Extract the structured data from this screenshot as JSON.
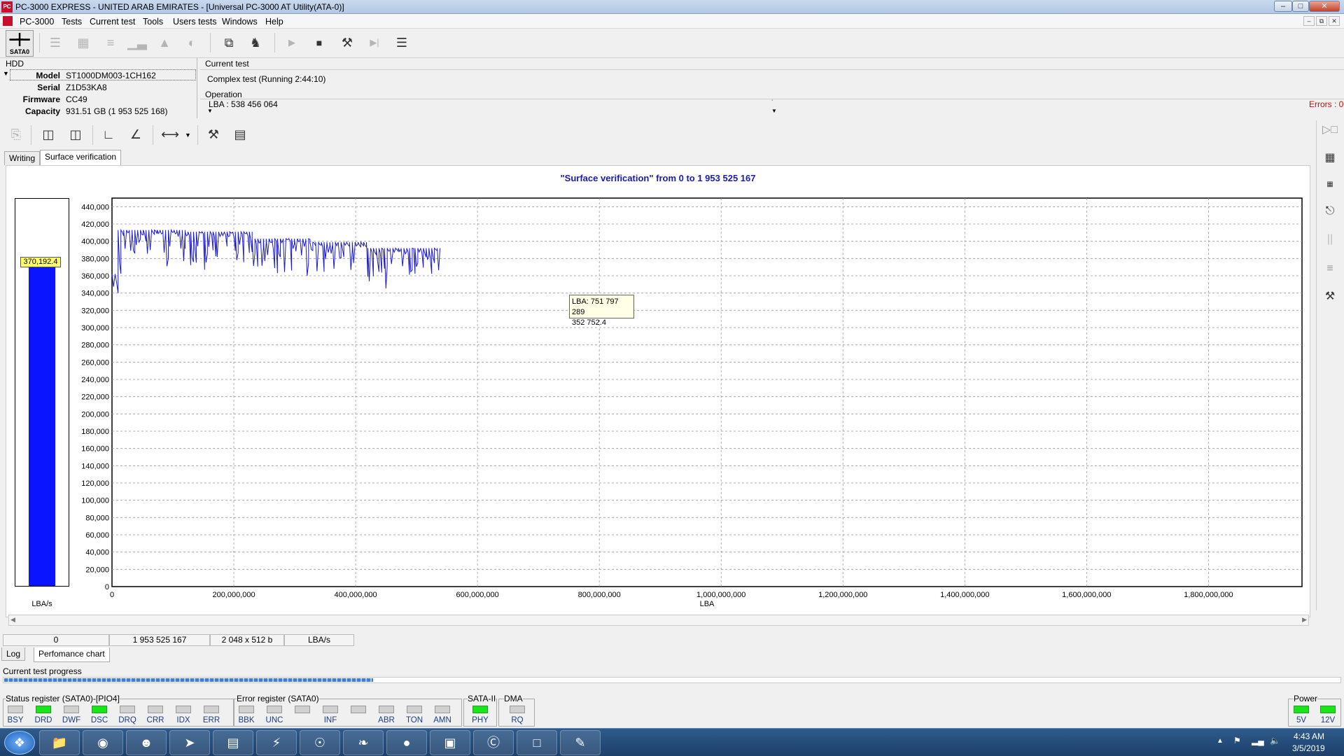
{
  "window": {
    "title": "PC-3000 EXPRESS - UNITED ARAB EMIRATES - [Universal PC-3000 AT Utility(ATA-0)]",
    "app_icon_text": "PC"
  },
  "menu": {
    "items": [
      "PC-3000",
      "Tests",
      "Current test",
      "Tools",
      "Users tests",
      "Windows",
      "Help"
    ]
  },
  "toolbar": {
    "sata_label": "SATA0"
  },
  "hdd": {
    "group_title": "HDD",
    "fields": [
      {
        "label": "Model",
        "value": "ST1000DM003-1CH162"
      },
      {
        "label": "Serial",
        "value": "Z1D53KA8"
      },
      {
        "label": "Firmware",
        "value": "CC49"
      },
      {
        "label": "Capacity",
        "value": "931.51 GB (1 953 525 168)"
      }
    ]
  },
  "current_test": {
    "group_title": "Current test",
    "value": "Complex test (Running 2:44:10)"
  },
  "operation": {
    "group_title": "Operation",
    "value": "LBA : 538 456 064",
    "errors_label": "Errors : 0"
  },
  "tabs": {
    "items": [
      "Writing",
      "Surface verification"
    ],
    "active": "Surface verification"
  },
  "chart_title": "\"Surface verification\" from 0 to 1 953 525 167",
  "gauge": {
    "value_label": "370,192.4",
    "value": 370192.4,
    "unit": "LBA/s",
    "max": 450000
  },
  "tooltip": {
    "line1": "LBA: 751 797 289",
    "line2": "352 752.4"
  },
  "chart_data": {
    "type": "line",
    "title": "\"Surface verification\" from 0 to 1 953 525 167",
    "xlabel": "LBA",
    "ylabel": "LBA/s",
    "xlim": [
      0,
      1953525167
    ],
    "ylim": [
      0,
      450000
    ],
    "yticks": [
      0,
      20000,
      40000,
      60000,
      80000,
      100000,
      120000,
      140000,
      160000,
      180000,
      200000,
      220000,
      240000,
      260000,
      280000,
      300000,
      320000,
      340000,
      360000,
      380000,
      400000,
      420000,
      440000
    ],
    "ytick_labels": [
      "0",
      "20,000",
      "40,000",
      "60,000",
      "80,000",
      "100,000",
      "120,000",
      "140,000",
      "160,000",
      "180,000",
      "200,000",
      "220,000",
      "240,000",
      "260,000",
      "280,000",
      "300,000",
      "320,000",
      "340,000",
      "360,000",
      "380,000",
      "400,000",
      "420,000",
      "440,000"
    ],
    "xticks": [
      0,
      200000000,
      400000000,
      600000000,
      800000000,
      1000000000,
      1200000000,
      1400000000,
      1600000000,
      1800000000
    ],
    "xtick_labels": [
      "0",
      "200,000,000",
      "400,000,000",
      "600,000,000",
      "800,000,000",
      "1,000,000,000",
      "1,200,000,000",
      "1,400,000,000",
      "1,600,000,000",
      "1,800,000,000"
    ],
    "grid": true,
    "series": [
      {
        "color": "#1a1acc",
        "segments": [
          {
            "x0": 0,
            "x1": 10000000,
            "y": 362000,
            "dip": 318000
          },
          {
            "x0": 10000000,
            "x1": 120000000,
            "y": 413000,
            "dip": 360000
          },
          {
            "x0": 120000000,
            "x1": 230000000,
            "y": 411000,
            "dip": 358000
          },
          {
            "x0": 230000000,
            "x1": 325000000,
            "y": 403000,
            "dip": 352000
          },
          {
            "x0": 325000000,
            "x1": 420000000,
            "y": 399000,
            "dip": 348000
          },
          {
            "x0": 420000000,
            "x1": 538456064,
            "y": 392000,
            "dip": 344000
          }
        ]
      }
    ]
  },
  "status_strip": {
    "cells": [
      "0",
      "1 953 525 167",
      "2 048 x 512 b",
      "LBA/s"
    ]
  },
  "bottom_tabs": {
    "items": [
      "Log",
      "Perfomance chart"
    ],
    "active": "Perfomance chart"
  },
  "progress": {
    "label": "Current test progress",
    "fraction": 0.276
  },
  "status_register": {
    "title": "Status register (SATA0)-[PIO4]",
    "leds": [
      {
        "name": "BSY",
        "on": false
      },
      {
        "name": "DRD",
        "on": true
      },
      {
        "name": "DWF",
        "on": false
      },
      {
        "name": "DSC",
        "on": true
      },
      {
        "name": "DRQ",
        "on": false
      },
      {
        "name": "CRR",
        "on": false
      },
      {
        "name": "IDX",
        "on": false
      },
      {
        "name": "ERR",
        "on": false
      }
    ]
  },
  "error_register": {
    "title": "Error register (SATA0)",
    "leds": [
      {
        "name": "BBK",
        "on": false
      },
      {
        "name": "UNC",
        "on": false
      },
      {
        "name": "",
        "on": false
      },
      {
        "name": "INF",
        "on": false
      },
      {
        "name": "",
        "on": false
      },
      {
        "name": "ABR",
        "on": false
      },
      {
        "name": "TON",
        "on": false
      },
      {
        "name": "AMN",
        "on": false
      }
    ]
  },
  "sata2": {
    "title": "SATA-II",
    "led": {
      "name": "PHY",
      "on": true
    }
  },
  "dma": {
    "title": "DMA",
    "led": {
      "name": "RQ",
      "on": false
    }
  },
  "power": {
    "title": "Power",
    "leds": [
      {
        "name": "5V",
        "on": true
      },
      {
        "name": "12V",
        "on": true
      }
    ]
  },
  "taskbar": {
    "apps": [
      "folder-icon",
      "chrome-icon",
      "qq-icon",
      "telegram-icon",
      "notepad-icon",
      "pc3000-icon",
      "mrt-icon",
      "tool-icon",
      "disk-icon",
      "monitor-icon",
      "skype-icon",
      "window-icon",
      "paint-icon"
    ],
    "time": "4:43 AM",
    "date": "3/5/2019"
  }
}
